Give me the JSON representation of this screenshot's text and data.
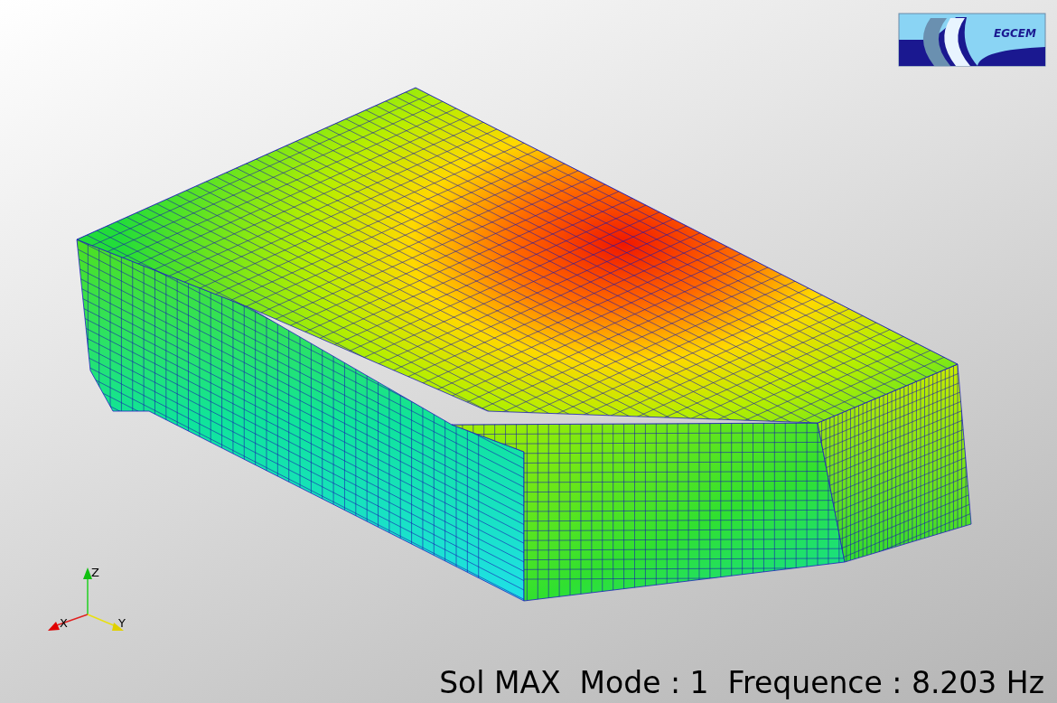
{
  "logo": {
    "text": "EGCEM"
  },
  "axes": {
    "x": "X",
    "y": "Y",
    "z": "Z"
  },
  "caption": "Sol MAX  Mode : 1  Frequence : 8.203 Hz"
}
